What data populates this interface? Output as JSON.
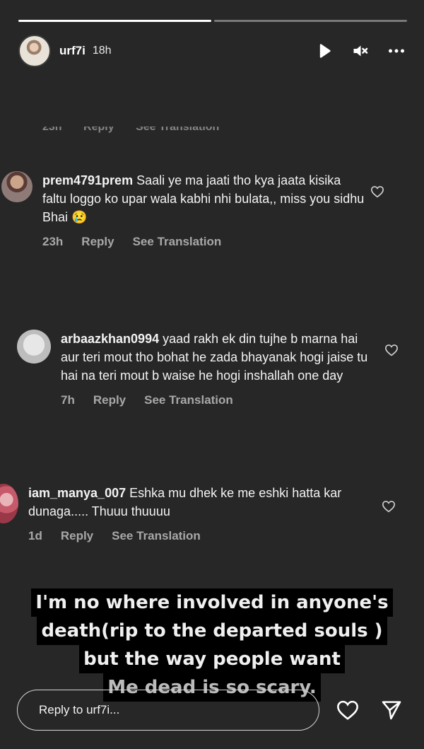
{
  "story": {
    "username": "urf7i",
    "time": "18h",
    "progress": [
      1.0,
      0.0
    ]
  },
  "ghost_comment": {
    "time": "23h",
    "reply": "Reply",
    "see_translation": "See Translation"
  },
  "comments": [
    {
      "username": "prem4791prem",
      "text": "Saali ye ma jaati tho kya jaata kisika faltu loggo ko upar wala kabhi nhi bulata,, miss you sidhu Bhai 😢",
      "time": "23h",
      "reply": "Reply",
      "see_translation": "See Translation"
    },
    {
      "username": "arbaazkhan0994",
      "text": "yaad rakh ek din tujhe b marna hai aur teri mout tho bohat he zada bhayanak hogi jaise tu hai na teri mout b waise he hogi inshallah one day",
      "time": "7h",
      "reply": "Reply",
      "see_translation": "See Translation"
    },
    {
      "username": "iam_manya_007",
      "text": "Eshka mu dhek ke me eshki hatta kar dunaga..... Thuuu thuuuu",
      "time": "1d",
      "reply": "Reply",
      "see_translation": "See Translation"
    }
  ],
  "caption": {
    "line1": "I'm no where involved in anyone's",
    "line2": "death(rip to the departed souls )",
    "line3": "but the way people want",
    "line4": "Me dead is so scary."
  },
  "reply_bar": {
    "placeholder": "Reply to urf7i..."
  },
  "icons": {
    "play": "play-icon",
    "mute": "mute-icon",
    "more": "more-icon",
    "heart": "heart-icon",
    "send": "send-icon"
  }
}
